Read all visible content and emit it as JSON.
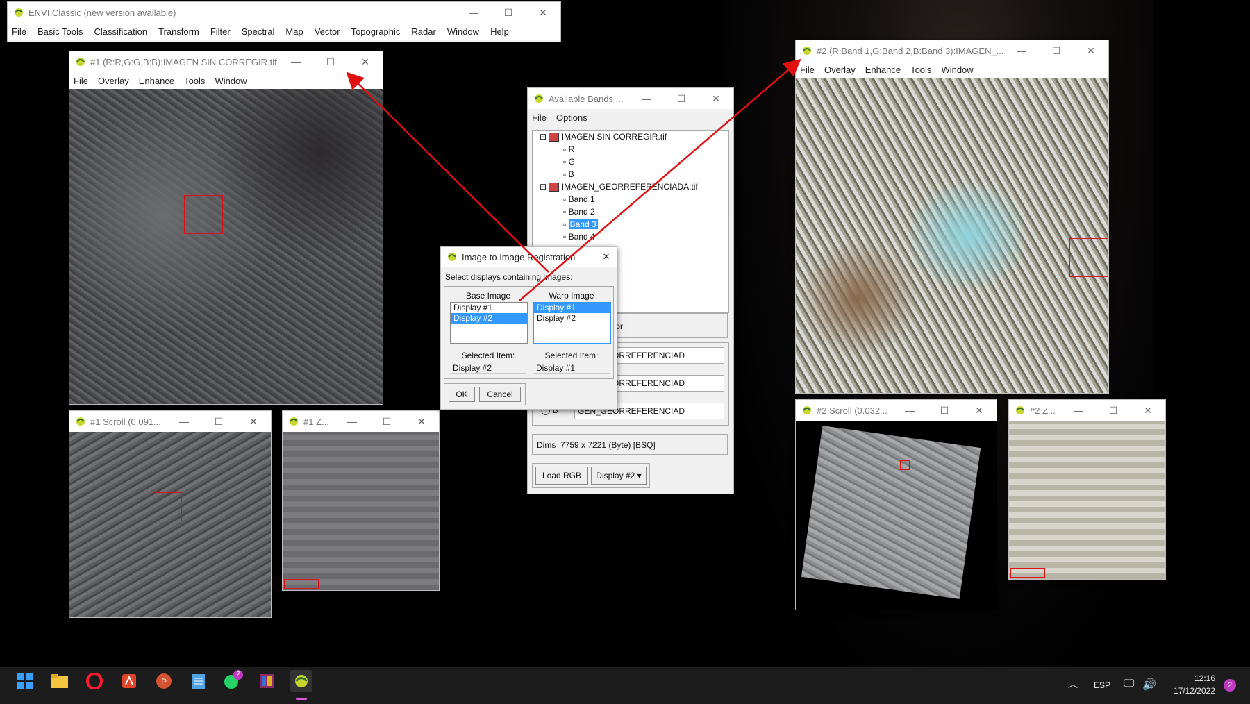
{
  "main_window": {
    "title": "ENVI Classic (new version available)",
    "menu": [
      "File",
      "Basic Tools",
      "Classification",
      "Transform",
      "Filter",
      "Spectral",
      "Map",
      "Vector",
      "Topographic",
      "Radar",
      "Window",
      "Help"
    ]
  },
  "display1": {
    "title": "#1 (R:R,G:G,B:B):IMAGEN SIN CORREGIR.tif",
    "menu": [
      "File",
      "Overlay",
      "Enhance",
      "Tools",
      "Window"
    ]
  },
  "display1_scroll": {
    "title": "#1 Scroll (0.091..."
  },
  "display1_zoom": {
    "title": "#1 Z..."
  },
  "display2": {
    "title": "#2 (R:Band 1,G:Band 2,B:Band 3):IMAGEN_...",
    "menu": [
      "File",
      "Overlay",
      "Enhance",
      "Tools",
      "Window"
    ]
  },
  "display2_scroll": {
    "title": "#2 Scroll (0.032..."
  },
  "display2_zoom": {
    "title": "#2 Z..."
  },
  "bands": {
    "title": "Available Bands ...",
    "menu": [
      "File",
      "Options"
    ],
    "files": [
      {
        "name": "IMAGEN SIN CORREGIR.tif",
        "bands": [
          "R",
          "G",
          "B"
        ]
      },
      {
        "name": "IMAGEN_GEORREFERENCIADA.tif",
        "bands": [
          "Band 1",
          "Band 2",
          "Band 3",
          "Band 4"
        ]
      }
    ],
    "selected_band": "Band 3",
    "rgb_color_label": "GB Color",
    "fields": [
      "GEN_GEORREFERENCIAD",
      "GEN_GEORREFERENCIAD",
      "GEN_GEORREFERENCIAD"
    ],
    "radio_b": "B",
    "dims_label": "Dims",
    "dims_value": "7759 x 7221 (Byte) [BSQ]",
    "load_rgb": "Load RGB",
    "display_select": "Display #2"
  },
  "reg_dialog": {
    "title": "Image to Image Registration",
    "prompt": "Select displays containing images:",
    "base_header": "Base Image",
    "warp_header": "Warp Image",
    "base_list": [
      "Display #1",
      "Display #2"
    ],
    "warp_list": [
      "Display #1",
      "Display #2"
    ],
    "base_selected": "Display #2",
    "warp_selected": "Display #1",
    "selected_label": "Selected Item:",
    "ok": "OK",
    "cancel": "Cancel"
  },
  "taskbar": {
    "lang": "ESP",
    "time": "12:16",
    "date": "17/12/2022",
    "notif_count": "2",
    "whatsapp_badge": "2"
  },
  "colors": {
    "arrow": "#e01010",
    "selection": "#3399ff"
  }
}
